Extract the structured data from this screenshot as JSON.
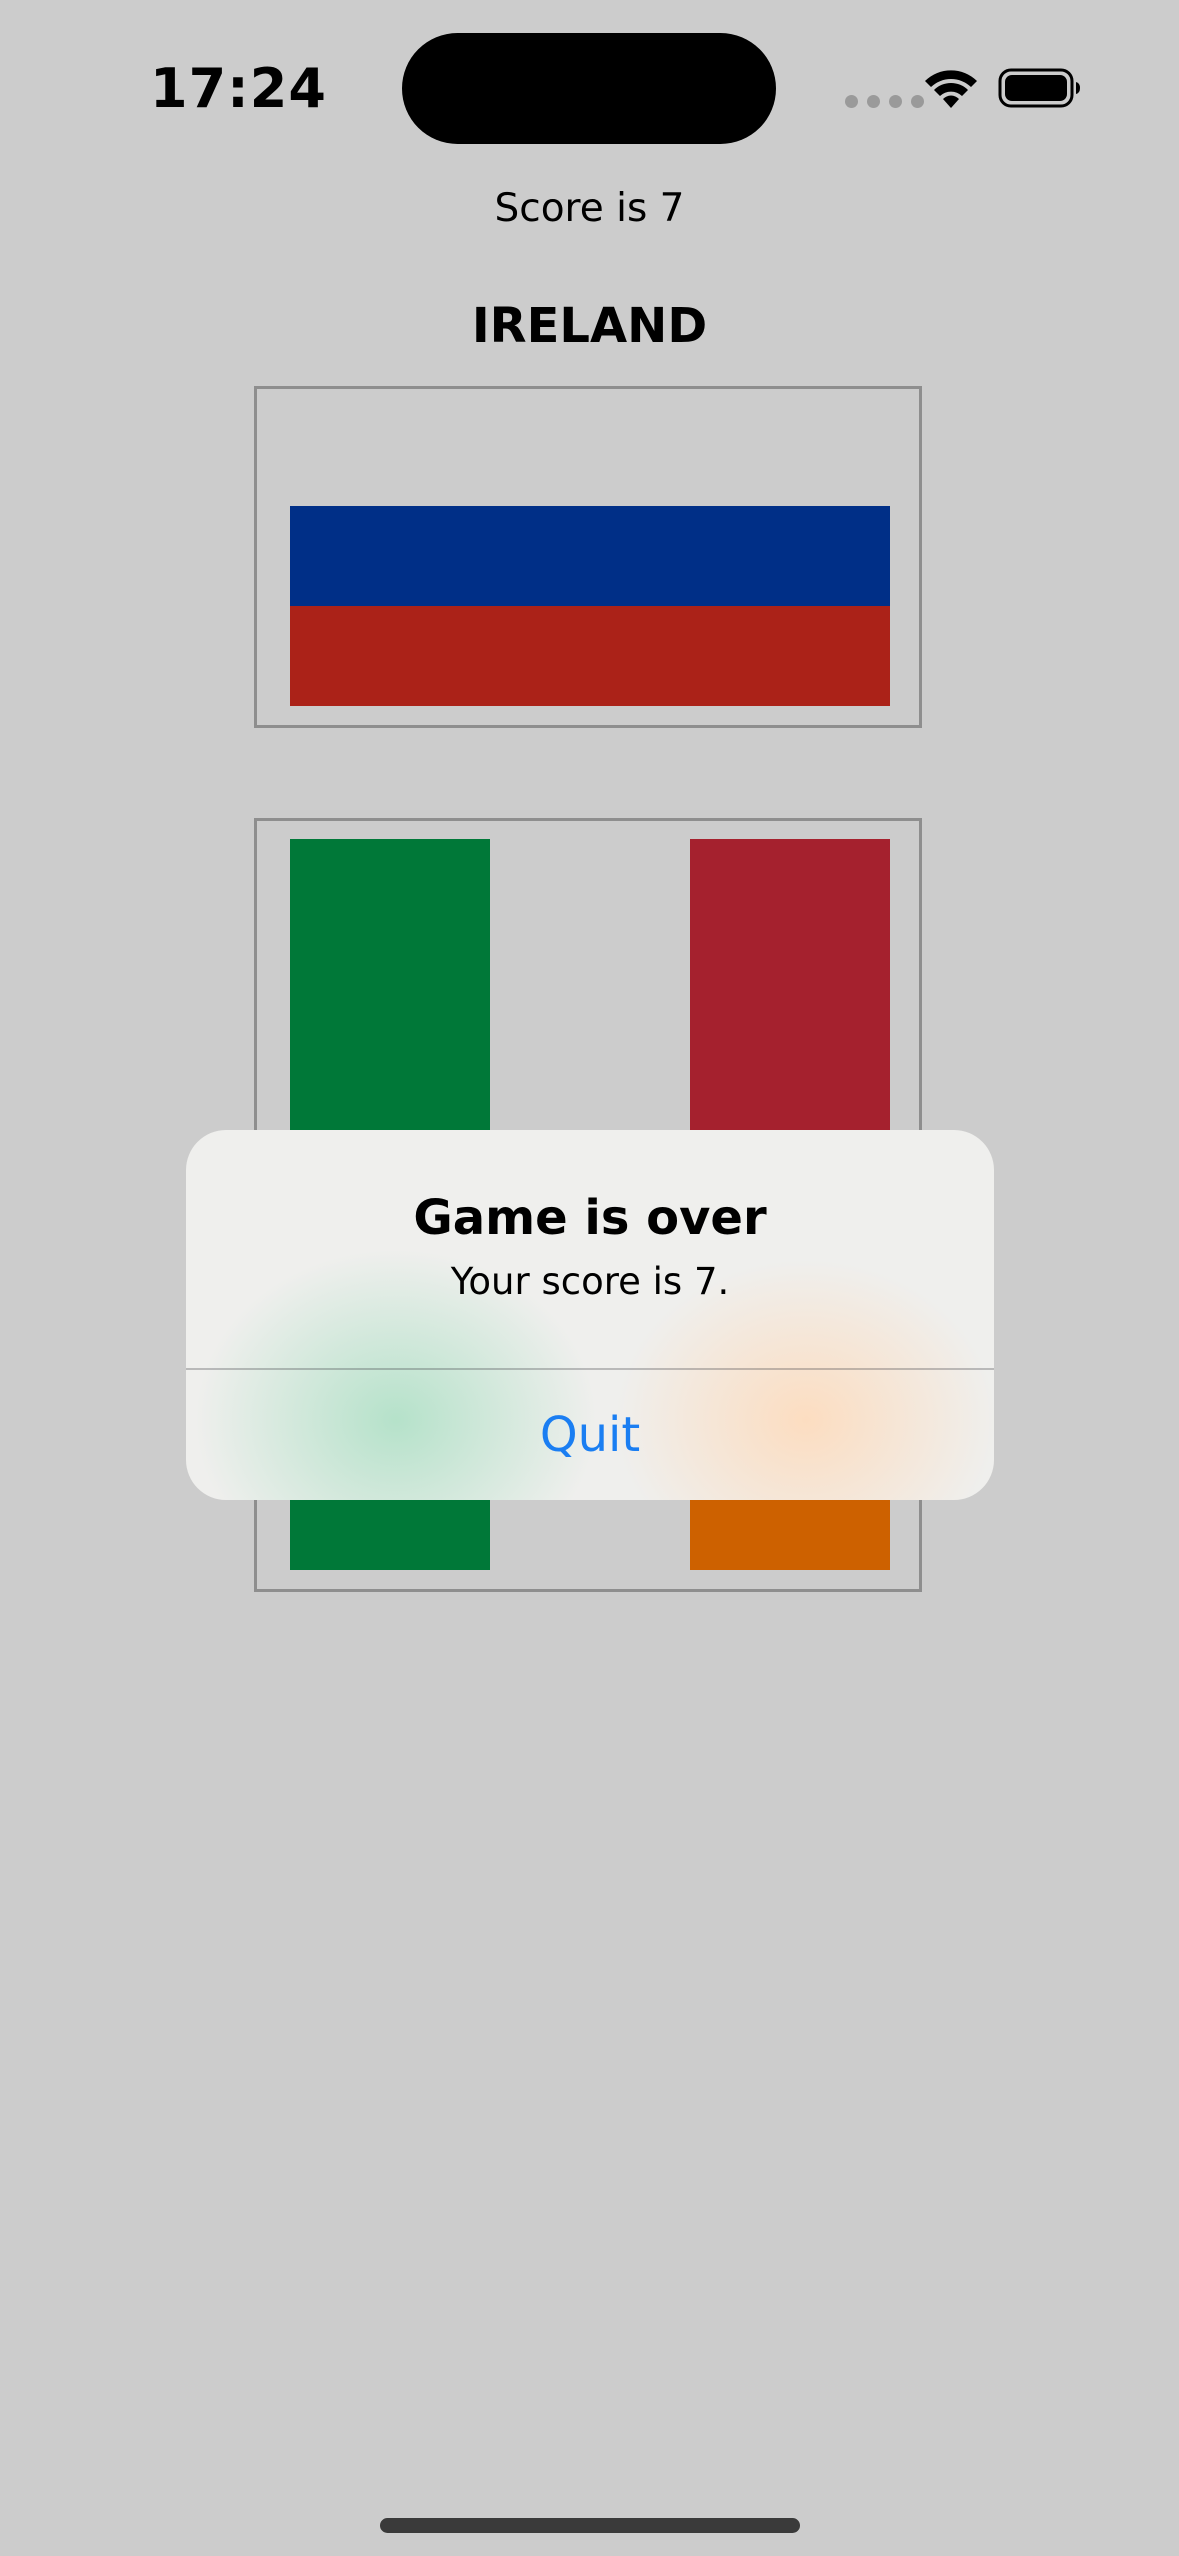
{
  "status_bar": {
    "time": "17:24",
    "icons": [
      "cellular-signal-icon",
      "wifi-icon",
      "battery-icon"
    ]
  },
  "game": {
    "score_text": "Score is 7",
    "country_title": "IRELAND",
    "flags": [
      {
        "name": "russia-like",
        "colors": [
          "#cccccc",
          "#002f87",
          "#ab2218"
        ]
      },
      {
        "name": "ireland-like",
        "colors": [
          "#007838",
          "#cccccc",
          "#a5212e"
        ],
        "obscured_bottom_colors": [
          "#007838",
          "#cccccc",
          "#cd6100"
        ]
      }
    ]
  },
  "alert": {
    "title": "Game is over",
    "message": "Your score is 7.",
    "action_label": "Quit",
    "action_color": "#1a7ef2"
  }
}
